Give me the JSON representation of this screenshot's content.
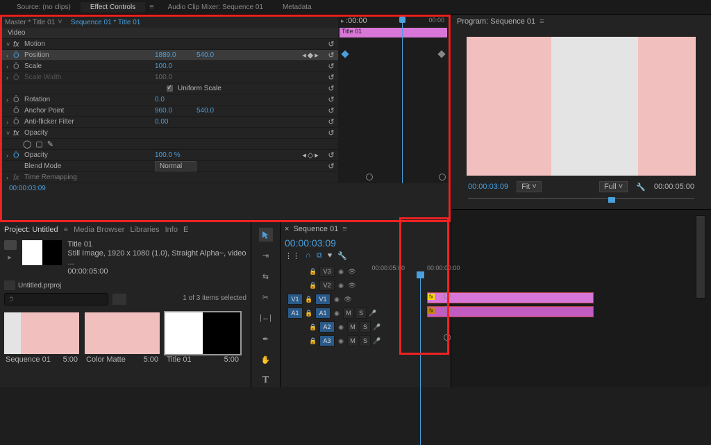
{
  "top_tabs": {
    "source": "Source: (no clips)",
    "effect_controls": "Effect Controls",
    "mixer": "Audio Clip Mixer: Sequence 01",
    "metadata": "Metadata"
  },
  "effect_controls": {
    "master": "Master * Title 01",
    "sequence": "Sequence 01 * Title 01",
    "timeline_label_1": ":00:00",
    "timeline_label_2": "00:00",
    "clip_name": "Title 01",
    "video_group": "Video",
    "motion": {
      "label": "Motion",
      "position": {
        "label": "Position",
        "x": "1889.0",
        "y": "540.0"
      },
      "scale": {
        "label": "Scale",
        "val": "100.0"
      },
      "scale_width": {
        "label": "Scale Width",
        "val": "100.0"
      },
      "uniform_scale": "Uniform Scale",
      "rotation": {
        "label": "Rotation",
        "val": "0.0"
      },
      "anchor": {
        "label": "Anchor Point",
        "x": "960.0",
        "y": "540.0"
      },
      "antiflicker": {
        "label": "Anti-flicker Filter",
        "val": "0.00"
      }
    },
    "opacity": {
      "label": "Opacity",
      "opacity_prop": {
        "label": "Opacity",
        "val": "100.0 %"
      },
      "blend_mode": {
        "label": "Blend Mode",
        "val": "Normal"
      }
    },
    "time_remap": "Time Remapping",
    "footer_tc": "00:00:03:09"
  },
  "program": {
    "header": "Program: Sequence 01",
    "tc_left": "00:00:03:09",
    "fit": "Fit",
    "full": "Full",
    "tc_right": "00:00:05:00"
  },
  "project": {
    "tabs": {
      "project": "Project: Untitled",
      "media": "Media Browser",
      "lib": "Libraries",
      "info": "Info",
      "e": "E"
    },
    "clip": {
      "name": "Title 01",
      "details": "Still Image, 1920 x 1080 (1.0), Straight Alpha~, video ...",
      "duration": "00:00:05:00"
    },
    "file": "Untitled.prproj",
    "selected": "1 of 3 items selected",
    "items": [
      {
        "name": "Sequence 01",
        "dur": "5:00"
      },
      {
        "name": "Color Matte",
        "dur": "5:00"
      },
      {
        "name": "Title 01",
        "dur": "5:00"
      }
    ]
  },
  "timeline": {
    "tab": "Sequence 01",
    "tc": "00:00:03:09",
    "ruler": {
      "t1": "00:00:00:00",
      "t2": "00:00:05:00"
    },
    "tracks": {
      "v3": "V3",
      "v2": "V2",
      "v1": "V1",
      "v1_src": "V1",
      "a1": "A1",
      "a1_src": "A1",
      "a2": "A2",
      "a3": "A3"
    },
    "fx": "fx",
    "m": "M",
    "s": "S"
  }
}
